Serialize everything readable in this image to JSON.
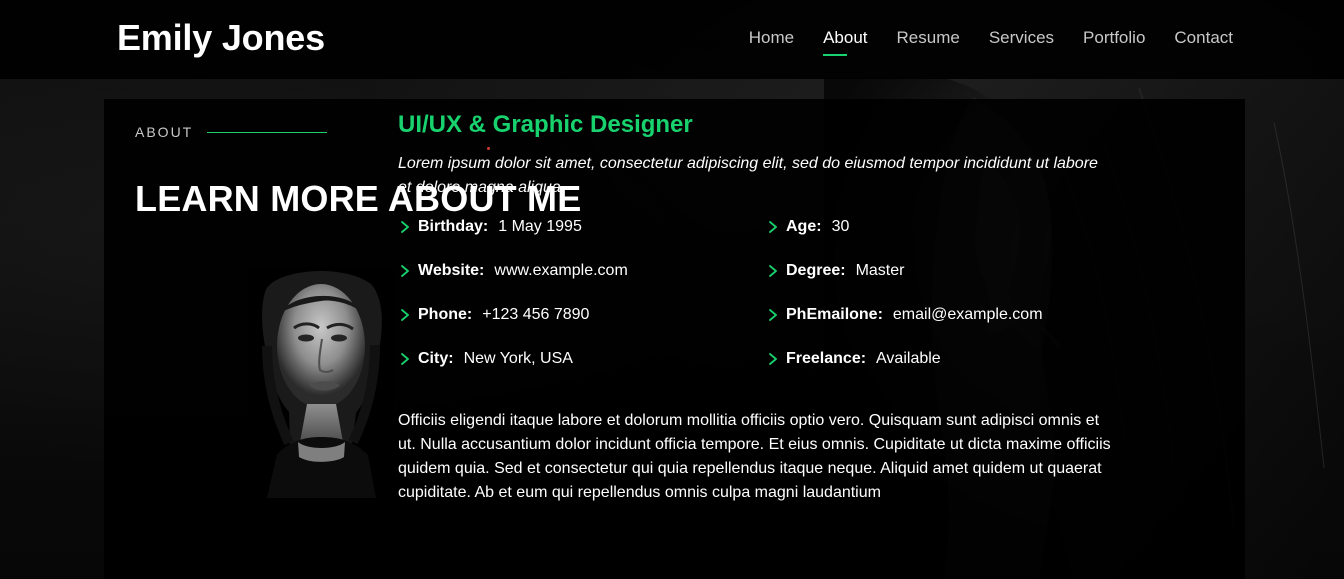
{
  "header": {
    "brand": "Emily Jones",
    "nav": [
      "Home",
      "About",
      "Resume",
      "Services",
      "Portfolio",
      "Contact"
    ],
    "active_nav": "About"
  },
  "about": {
    "label": "ABOUT",
    "title": "LEARN MORE ABOUT ME",
    "job_title": "UI/UX & Graphic Designer",
    "intro": "Lorem ipsum dolor sit amet, consectetur adipiscing elit, sed do eiusmod tempor incididunt ut labore et dolore magna aliqua.",
    "details_left": [
      {
        "label": "Birthday:",
        "value": "1 May 1995"
      },
      {
        "label": "Website:",
        "value": "www.example.com"
      },
      {
        "label": "Phone:",
        "value": "+123 456 7890"
      },
      {
        "label": "City:",
        "value": "New York, USA"
      }
    ],
    "details_right": [
      {
        "label": "Age:",
        "value": "30"
      },
      {
        "label": "Degree:",
        "value": "Master"
      },
      {
        "label": "PhEmailone:",
        "value": "email@example.com"
      },
      {
        "label": "Freelance:",
        "value": "Available"
      }
    ],
    "paragraph": "Officiis eligendi itaque labore et dolorum mollitia officiis optio vero. Quisquam sunt adipisci omnis et ut. Nulla accusantium dolor incidunt officia tempore. Et eius omnis. Cupiditate ut dicta maxime officiis quidem quia. Sed et consectetur qui quia repellendus itaque neque. Aliquid amet quidem ut quaerat cupiditate. Ab et eum qui repellendus omnis culpa magni laudantium"
  },
  "colors": {
    "accent": "#18d26e",
    "background": "#0c0c0c",
    "panel": "#000000",
    "text": "#ffffff",
    "muted": "#c8c8c8"
  }
}
